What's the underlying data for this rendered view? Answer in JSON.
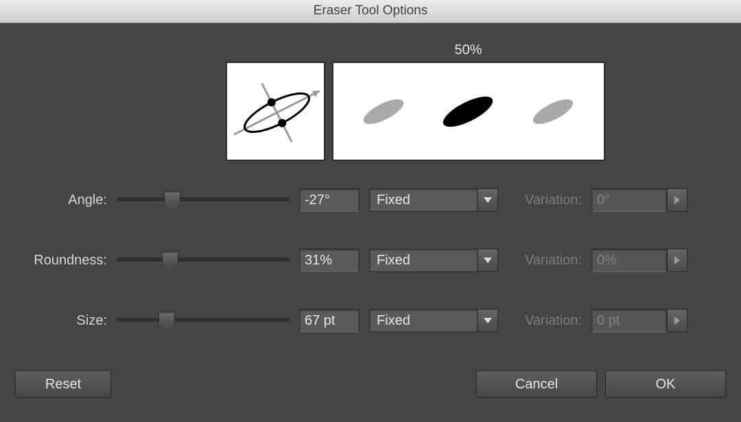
{
  "title": "Eraser Tool Options",
  "preview": {
    "intensity_label": "50%",
    "angle_deg": -27,
    "roundness_pct": 31
  },
  "angle": {
    "label": "Angle:",
    "value": "-27°",
    "mode": "Fixed",
    "slider_pct": 32,
    "variation_label": "Variation:",
    "variation_value": "0°"
  },
  "roundness": {
    "label": "Roundness:",
    "value": "31%",
    "mode": "Fixed",
    "slider_pct": 31,
    "variation_label": "Variation:",
    "variation_value": "0%"
  },
  "size": {
    "label": "Size:",
    "value": "67 pt",
    "mode": "Fixed",
    "slider_pct": 29,
    "variation_label": "Variation:",
    "variation_value": "0 pt"
  },
  "buttons": {
    "reset": "Reset",
    "cancel": "Cancel",
    "ok": "OK"
  }
}
